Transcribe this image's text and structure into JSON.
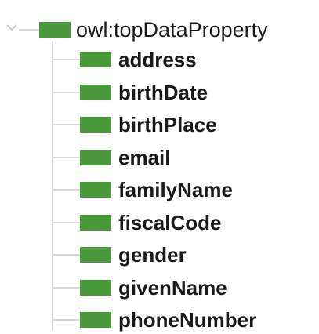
{
  "colors": {
    "property_swatch": "#4a9a3c"
  },
  "tree": {
    "root": {
      "label": "owl:topDataProperty",
      "expanded": true,
      "icon": "data-property-icon",
      "toggle_icon": "chevron-down-icon"
    },
    "children": [
      {
        "label": "address",
        "icon": "data-property-icon"
      },
      {
        "label": "birthDate",
        "icon": "data-property-icon"
      },
      {
        "label": "birthPlace",
        "icon": "data-property-icon"
      },
      {
        "label": "email",
        "icon": "data-property-icon"
      },
      {
        "label": "familyName",
        "icon": "data-property-icon"
      },
      {
        "label": "fiscalCode",
        "icon": "data-property-icon"
      },
      {
        "label": "gender",
        "icon": "data-property-icon"
      },
      {
        "label": "givenName",
        "icon": "data-property-icon"
      },
      {
        "label": "phoneNumber",
        "icon": "data-property-icon"
      }
    ]
  }
}
